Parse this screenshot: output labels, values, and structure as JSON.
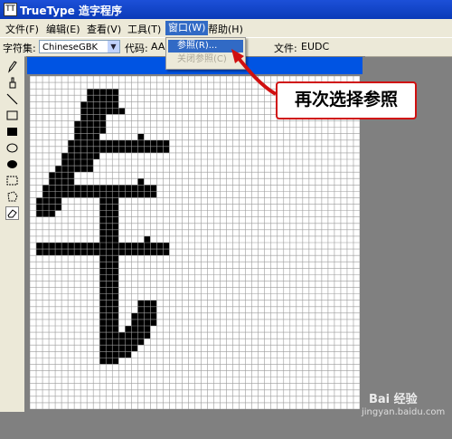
{
  "window": {
    "title": "TrueType 造字程序",
    "app_icon": "TT"
  },
  "menu": {
    "items": [
      {
        "label": "文件(F)"
      },
      {
        "label": "编辑(E)"
      },
      {
        "label": "查看(V)"
      },
      {
        "label": "工具(T)"
      },
      {
        "label": "窗口(W)"
      },
      {
        "label": "帮助(H)"
      }
    ],
    "active_index": 4
  },
  "dropdown": {
    "items": [
      {
        "label": "参照(R)...",
        "state": "highlighted"
      },
      {
        "label": "关闭参照(C)",
        "state": "disabled"
      }
    ]
  },
  "toolbar": {
    "charset_label": "字符集:",
    "charset_value": "ChineseGBK",
    "code_label": "代码:",
    "code_value": "AAA",
    "file_label": "文件:",
    "file_value": "EUDC"
  },
  "tools": [
    {
      "icon": "pencil-icon"
    },
    {
      "icon": "brush-icon"
    },
    {
      "icon": "line-icon"
    },
    {
      "icon": "hollow-rectangle-icon"
    },
    {
      "icon": "filled-rectangle-icon"
    },
    {
      "icon": "hollow-ellipse-icon"
    },
    {
      "icon": "filled-ellipse-icon"
    },
    {
      "icon": "rect-select-icon"
    },
    {
      "icon": "freeform-select-icon"
    },
    {
      "icon": "eraser-icon"
    }
  ],
  "annotation": {
    "callout_text": "再次选择参照"
  },
  "watermark": {
    "brand": "Bai 经验",
    "url": "jingyan.baidu.com"
  },
  "colors": {
    "title_bar": "#0a3ab8",
    "highlight": "#316ac5",
    "callout_border": "#d01010",
    "glyph": "#000000"
  }
}
